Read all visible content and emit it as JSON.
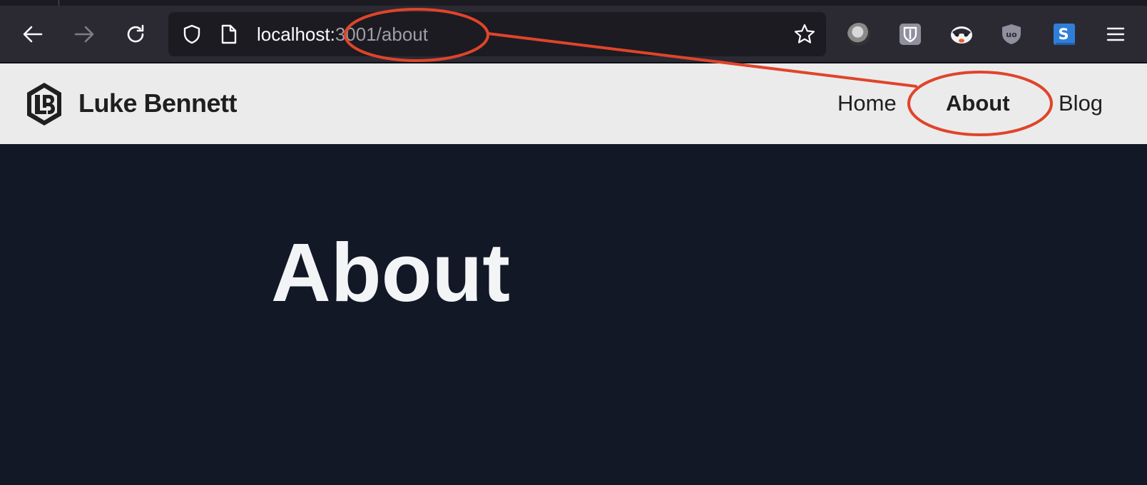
{
  "browser": {
    "url_host": "localhost:",
    "url_path": "3001/about",
    "icons": {
      "back": "back-arrow-icon",
      "forward": "forward-arrow-icon",
      "reload": "reload-icon",
      "tracking_protection": "shield-icon",
      "page_info": "page-icon",
      "bookmark": "star-icon",
      "menu": "hamburger-menu-icon"
    },
    "extensions": [
      {
        "name": "avatar-icon"
      },
      {
        "name": "bitwarden-icon"
      },
      {
        "name": "privacy-badger-icon"
      },
      {
        "name": "ublock-icon",
        "label": "uo"
      },
      {
        "name": "s-extension-icon",
        "label": "S"
      }
    ]
  },
  "site": {
    "brand": "Luke Bennett",
    "logo_letters": "LB",
    "nav": [
      {
        "label": "Home",
        "active": false
      },
      {
        "label": "About",
        "active": true
      },
      {
        "label": "Blog",
        "active": false
      }
    ]
  },
  "main": {
    "title": "About"
  },
  "colors": {
    "page_bg": "#121826",
    "header_bg": "#ebebeb",
    "toolbar_bg": "#2b2a33",
    "annotation": "#e0442a"
  }
}
